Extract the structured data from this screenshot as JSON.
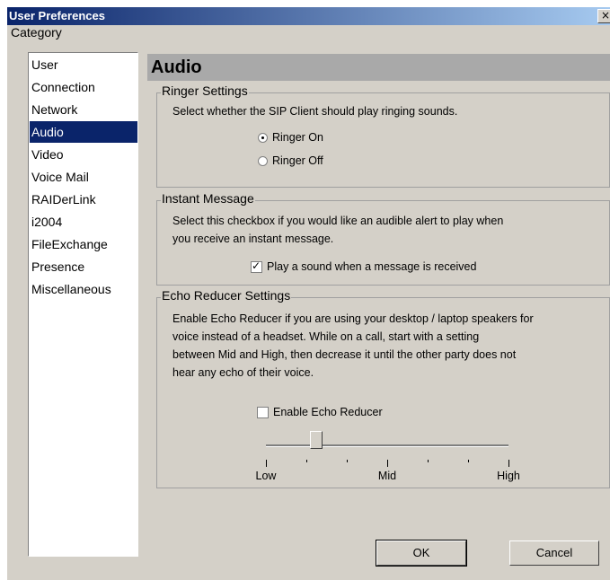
{
  "window": {
    "title": "User Preferences",
    "close_glyph": "×"
  },
  "sidebar": {
    "label": "Category",
    "selected": "Audio",
    "items": [
      {
        "label": "User"
      },
      {
        "label": "Connection"
      },
      {
        "label": "Network"
      },
      {
        "label": "Audio"
      },
      {
        "label": "Video"
      },
      {
        "label": "Voice Mail"
      },
      {
        "label": "RAIDerLink"
      },
      {
        "label": "i2004"
      },
      {
        "label": "FileExchange"
      },
      {
        "label": "Presence"
      },
      {
        "label": "Miscellaneous"
      }
    ]
  },
  "panel": {
    "title": "Audio",
    "ringer": {
      "title": "Ringer Settings",
      "description": "Select whether the SIP Client should play ringing sounds.",
      "options": [
        {
          "label": "Ringer On",
          "selected": true
        },
        {
          "label": "Ringer Off",
          "selected": false
        }
      ]
    },
    "im": {
      "title": "Instant Message",
      "description_lines": [
        "Select this checkbox if you would like an audible alert to play when",
        "you receive an instant message."
      ],
      "checkbox_label": "Play a sound when a message is received",
      "checked": true
    },
    "echo": {
      "title": "Echo Reducer Settings",
      "description_lines": [
        "Enable Echo Reducer if you are using your desktop / laptop speakers for",
        "voice instead of a headset. While on a call, start with a setting",
        "between Mid and High, then decrease it until the other party does not",
        "hear any echo of their voice."
      ],
      "checkbox_label": "Enable Echo Reducer",
      "checked": false,
      "slider": {
        "labels": {
          "low": "Low",
          "mid": "Mid",
          "high": "High"
        },
        "value_fraction": 0.2
      }
    }
  },
  "buttons": {
    "ok": "OK",
    "cancel": "Cancel"
  },
  "colors": {
    "selection": "#0a246a",
    "header_bar": "#a9a9a9",
    "dialog_bg": "#d4d0c8"
  }
}
